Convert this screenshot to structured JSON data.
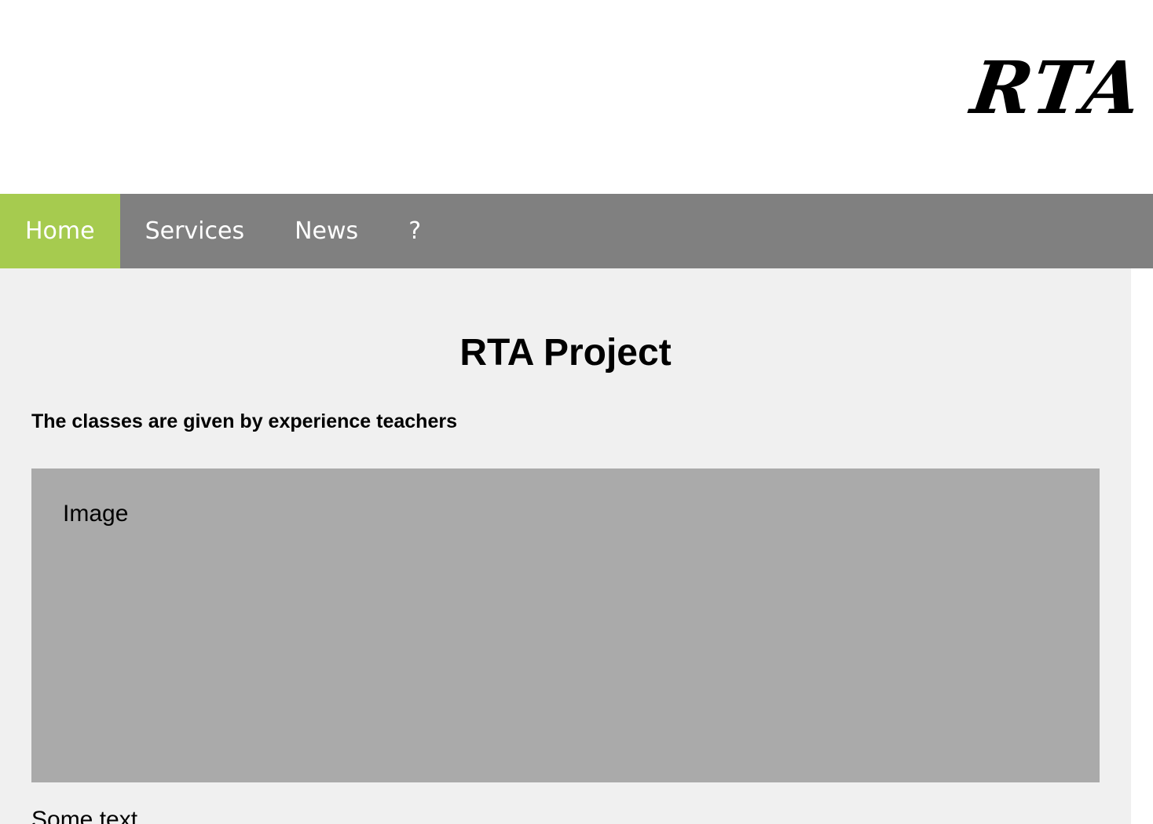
{
  "header": {
    "logo_text": "RTA Project"
  },
  "nav": {
    "items": [
      {
        "label": "Home",
        "active": true
      },
      {
        "label": "Services",
        "active": false
      },
      {
        "label": "News",
        "active": false
      },
      {
        "label": "?",
        "active": false
      }
    ]
  },
  "main": {
    "title": "RTA Project",
    "subtitle": "The classes are given by experience teachers",
    "image_label": "Image",
    "body_text": "Some text"
  },
  "colors": {
    "nav_background": "#808080",
    "nav_active": "#a6cb4f",
    "main_background": "#f0f0f0",
    "image_placeholder": "#aaaaaa"
  }
}
